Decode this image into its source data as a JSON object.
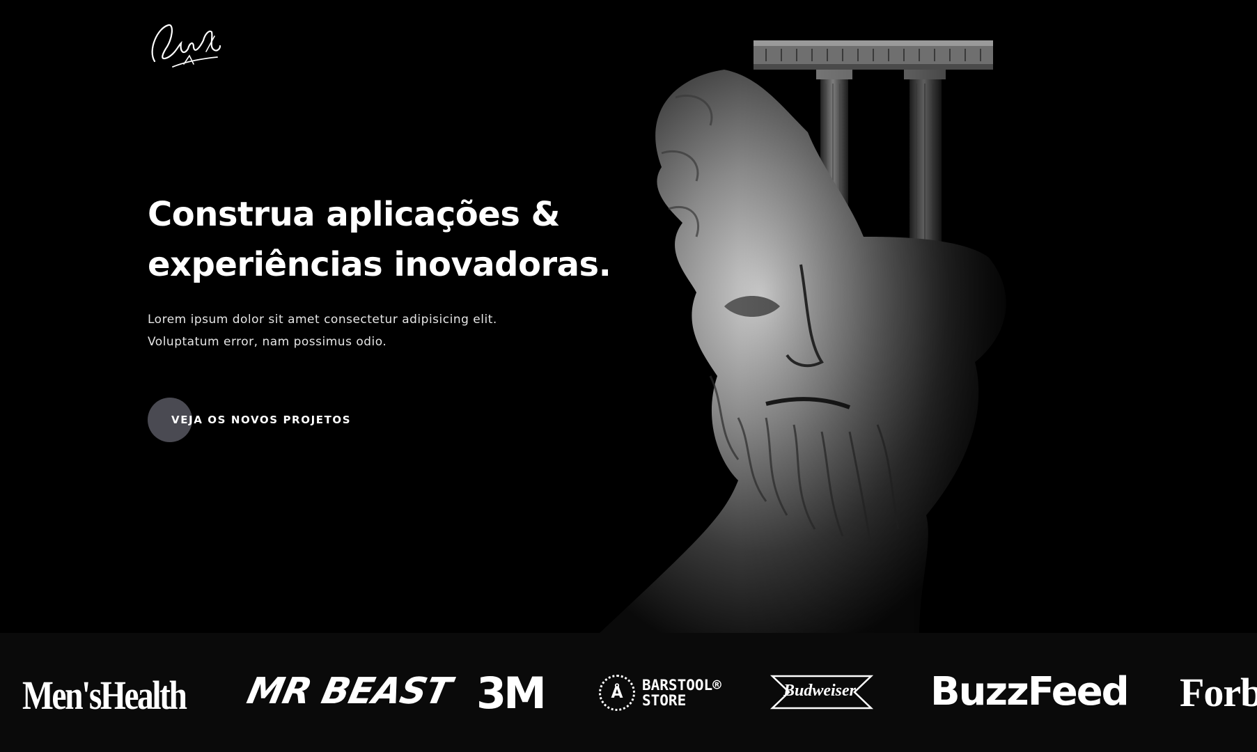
{
  "logo": {
    "icon": "signature-logo-icon"
  },
  "hero": {
    "headline_line1": "Construa aplicações &",
    "headline_line2": "experiências inovadoras.",
    "subtext_line1": "Lorem ipsum dolor sit amet consectetur adipisicing elit.",
    "subtext_line2": "Voluptatum error, nam possimus odio.",
    "cta_label": "VEJA OS NOVOS PROJETOS",
    "image": "greek-statue-with-columns-image"
  },
  "brands": {
    "mens_health": "Men'sHealth",
    "mr_beast": "MR BEAST",
    "three_m": "3M",
    "barstool_badge": "Å",
    "barstool_line1": "BARSTOOL®",
    "barstool_line2": "STORE",
    "budweiser": "Budweiser",
    "buzzfeed": "BuzzFeed",
    "forbes": "Forb"
  },
  "colors": {
    "background": "#000000",
    "brand_strip": "#0a0a0a",
    "cta_circle": "#4a4a52",
    "text": "#ffffff"
  }
}
